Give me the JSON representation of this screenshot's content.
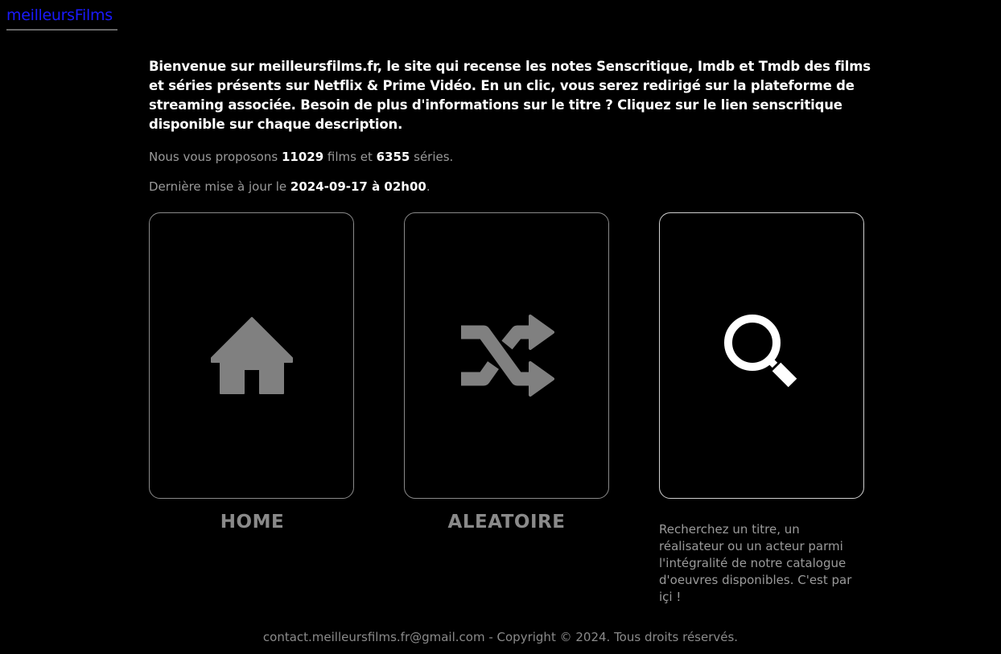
{
  "header": {
    "logo_text": "meilleursFilms"
  },
  "intro": {
    "text": "Bienvenue sur meilleursfilms.fr, le site qui recense les notes Senscritique, Imdb et Tmdb des films et séries présents sur Netflix & Prime Vidéo. En un clic, vous serez redirigé sur la plateforme de streaming associée. Besoin de plus d'informations sur le titre ? Cliquez sur le lien senscritique disponible sur chaque description."
  },
  "stats": {
    "prefix": "Nous vous proposons ",
    "films_count": "11029",
    "middle": " films et ",
    "series_count": "6355",
    "suffix": " séries."
  },
  "update": {
    "prefix": "Dernière mise à jour le ",
    "datetime": "2024-09-17 à 02h00",
    "suffix": "."
  },
  "cards": {
    "home": {
      "label": "HOME",
      "icon": "home-icon"
    },
    "random": {
      "label": "ALEATOIRE",
      "icon": "shuffle-icon"
    },
    "search": {
      "icon": "search-icon",
      "description": "Recherchez un titre, un réalisateur ou un acteur parmi l'intégralité de notre catalogue d'oeuvres disponibles. C'est par içi !"
    }
  },
  "footer": {
    "email": "contact.meilleursfilms.fr@gmail.com",
    "copyright": " - Copyright © 2024. Tous droits réservés."
  },
  "colors": {
    "background": "#000000",
    "logo": "#1a1aff",
    "muted_text": "#9a9a9a",
    "icon_gray": "#808080",
    "icon_white": "#ffffff"
  }
}
